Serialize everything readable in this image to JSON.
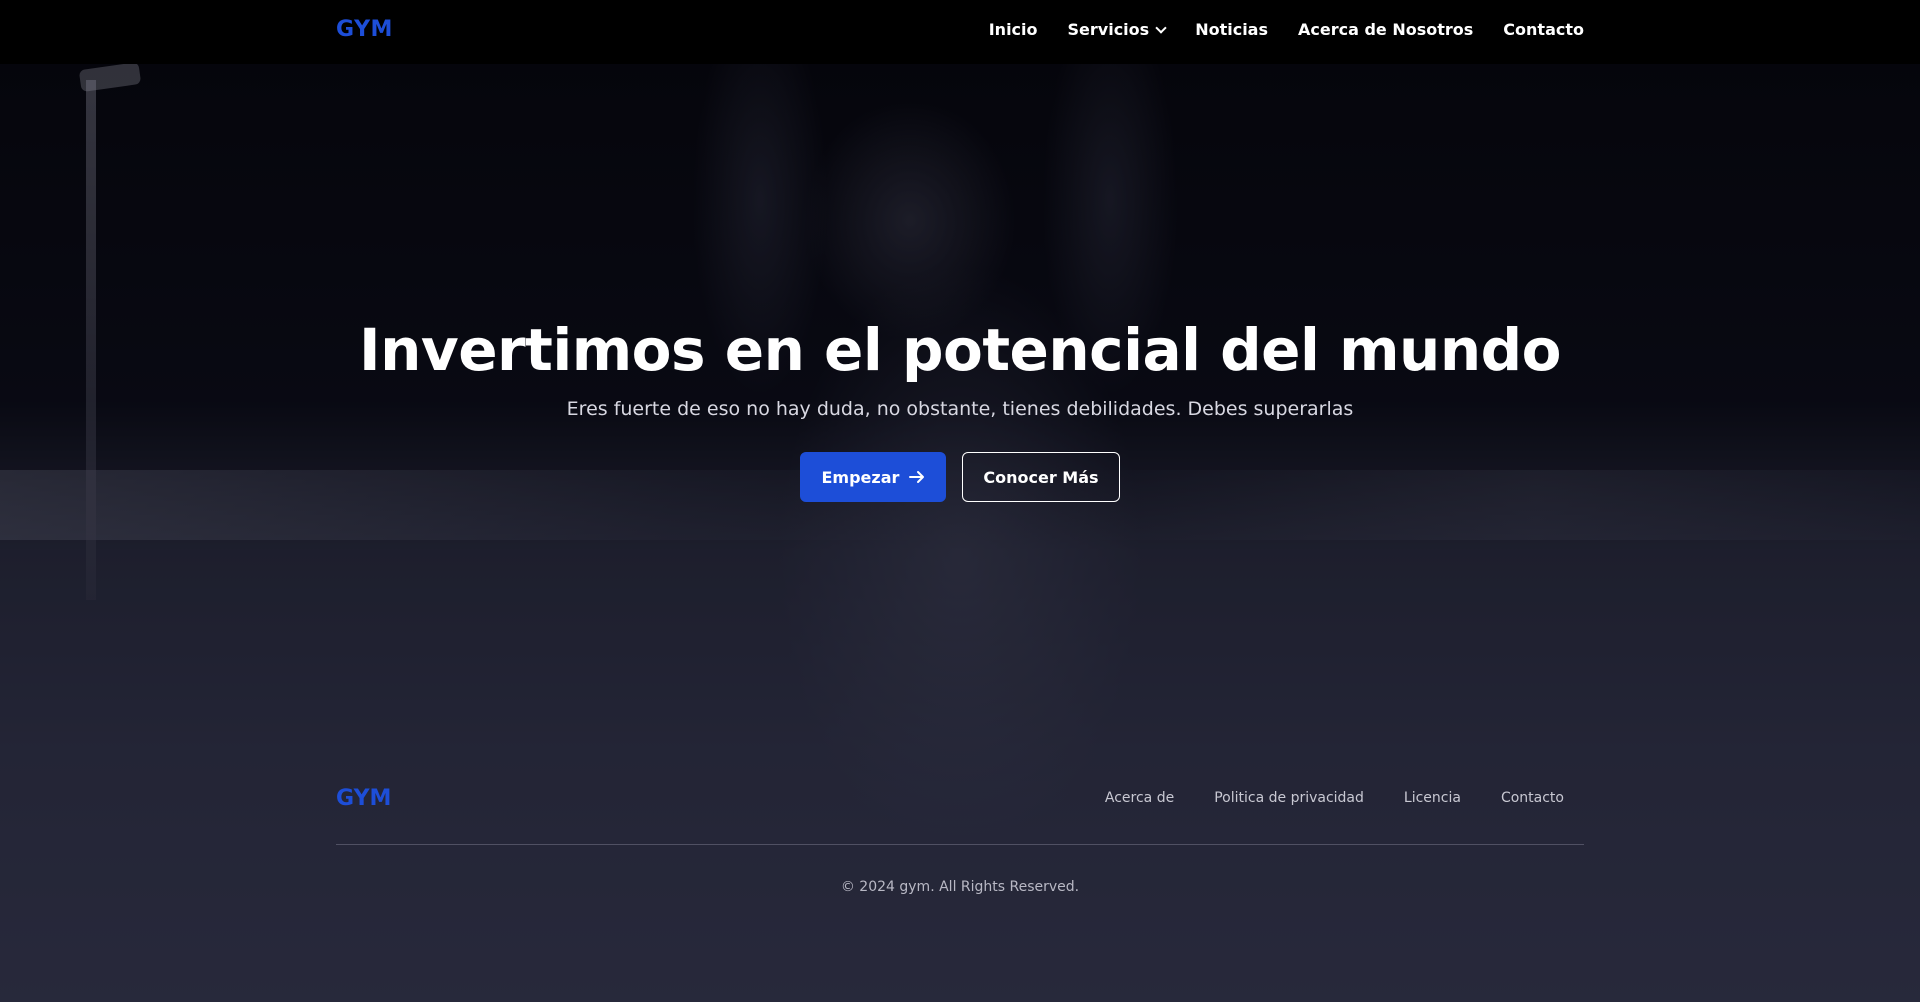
{
  "header": {
    "logo": "GYM",
    "nav": [
      {
        "label": "Inicio"
      },
      {
        "label": "Servicios",
        "dropdown": true
      },
      {
        "label": "Noticias"
      },
      {
        "label": "Acerca de Nosotros"
      },
      {
        "label": "Contacto"
      }
    ]
  },
  "hero": {
    "title": "Invertimos en el potencial del mundo",
    "subtitle": "Eres fuerte de eso no hay duda, no obstante, tienes debilidades. Debes superarlas",
    "primary_button": "Empezar",
    "primary_icon": "arrow-right-icon",
    "secondary_button": "Conocer Más"
  },
  "footer": {
    "logo": "GYM",
    "links": [
      "Acerca de",
      "Politica de privacidad",
      "Licencia",
      "Contacto"
    ],
    "copyright": "© 2024 gym. All Rights Reserved."
  },
  "colors": {
    "accent": "#1d4ed8",
    "header_bg": "#000000"
  }
}
